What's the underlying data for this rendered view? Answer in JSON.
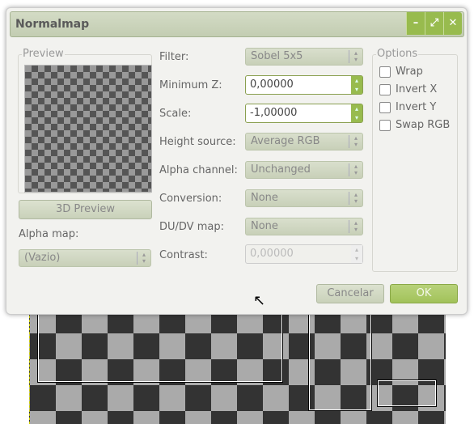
{
  "window": {
    "title": "Normalmap",
    "buttons": [
      "minimize",
      "maximize",
      "close"
    ]
  },
  "preview": {
    "label": "Preview",
    "button": "3D Preview"
  },
  "alpha_map": {
    "label": "Alpha map:",
    "value": "(Vazio)"
  },
  "fields": [
    {
      "label": "Filter:",
      "value": "Sobel 5x5",
      "type": "combo"
    },
    {
      "label": "Minimum Z:",
      "value": "0,00000",
      "type": "spin"
    },
    {
      "label": "Scale:",
      "value": "-1,00000",
      "type": "spin"
    },
    {
      "label": "Height source:",
      "value": "Average RGB",
      "type": "combo"
    },
    {
      "label": "Alpha channel:",
      "value": "Unchanged",
      "type": "combo"
    },
    {
      "label": "Conversion:",
      "value": "None",
      "type": "combo"
    },
    {
      "label": "DU/DV map:",
      "value": "None",
      "type": "combo"
    },
    {
      "label": "Contrast:",
      "value": "0,00000",
      "type": "spin-disabled"
    }
  ],
  "options": {
    "label": "Options",
    "items": [
      {
        "label": "Wrap",
        "checked": false
      },
      {
        "label": "Invert X",
        "checked": false
      },
      {
        "label": "Invert Y",
        "checked": false
      },
      {
        "label": "Swap RGB",
        "checked": false
      }
    ]
  },
  "actions": {
    "cancel": "Cancelar",
    "ok": "OK"
  }
}
